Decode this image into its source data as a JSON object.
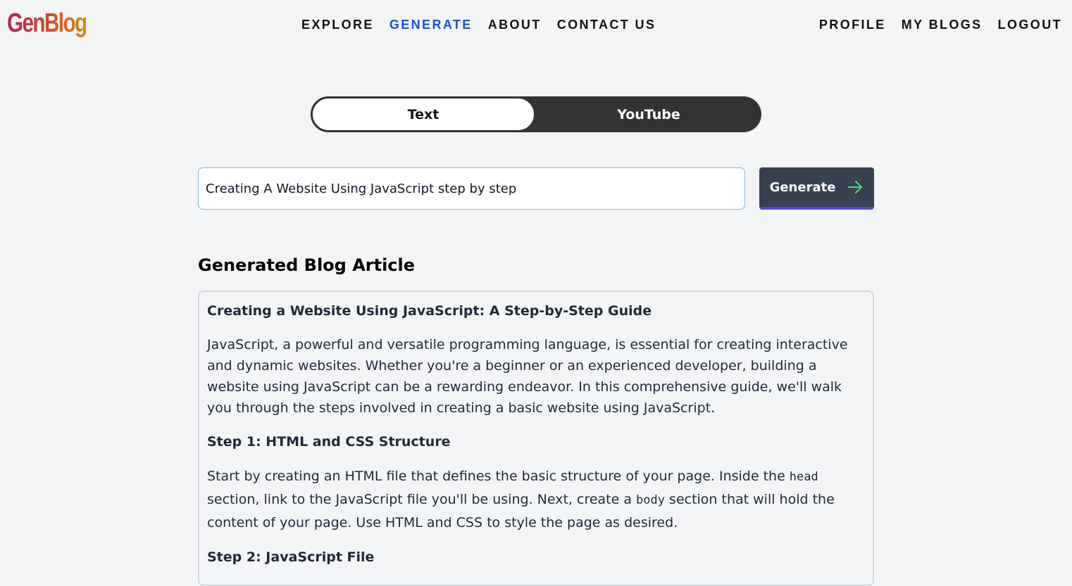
{
  "app": {
    "logo": "GenBlog"
  },
  "nav": {
    "center": [
      "EXPLORE",
      "GENERATE",
      "ABOUT",
      "CONTACT US"
    ],
    "right": [
      "PROFILE",
      "MY BLOGS",
      "LOGOUT"
    ],
    "active": "GENERATE",
    "active_color": "#1d4ed8"
  },
  "toggle": {
    "text_label": "Text",
    "youtube_label": "YouTube",
    "selected": "Text"
  },
  "prompt": {
    "value": "Creating A Website Using JavaScript step by step"
  },
  "generate_button": {
    "label": "Generate",
    "icon": "arrow-right-icon"
  },
  "section_title": "Generated Blog Article",
  "article": {
    "title": "Creating a Website Using JavaScript: A Step-by-Step Guide",
    "intro": "JavaScript, a powerful and versatile programming language, is essential for creating interactive and dynamic websites. Whether you're a beginner or an experienced developer, building a website using JavaScript can be a rewarding endeavor. In this comprehensive guide, we'll walk you through the steps involved in creating a basic website using JavaScript.",
    "step1_title": "Step 1: HTML and CSS Structure",
    "step1_p1": "Start by creating an HTML file that defines the basic structure of your page. Inside the ",
    "step1_code1": "head",
    "step1_p2": " section, link to the JavaScript file you'll be using. Next, create a ",
    "step1_code2": "body",
    "step1_p3": " section that will hold the content of your page. Use HTML and CSS to style the page as desired.",
    "step2_title": "Step 2: JavaScript File"
  },
  "colors": {
    "background": "#f3f4f6",
    "toggle_dark": "#333333",
    "button_bg": "#374151",
    "button_accent": "#4f46e5",
    "arrow": "#4ade80",
    "input_border": "#7fb6e3"
  }
}
